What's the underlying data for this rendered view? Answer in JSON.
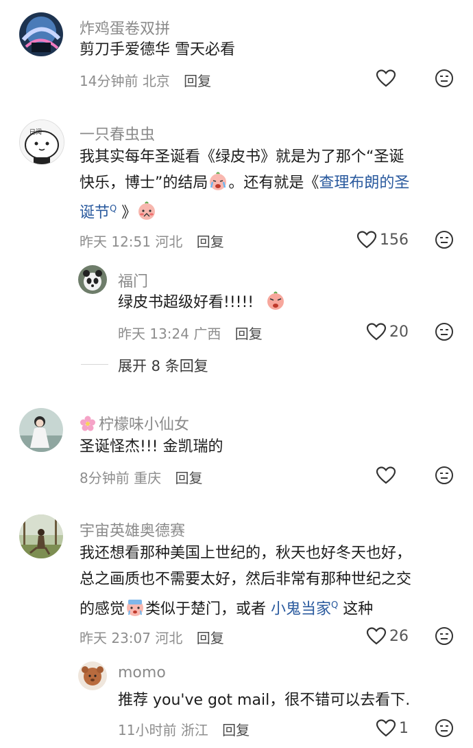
{
  "comments": [
    {
      "username": "炸鸡蛋卷双拼",
      "text": "剪刀手爱德华 雪天必看",
      "time": "14分钟前",
      "location": "北京",
      "reply_label": "回复",
      "likes": ""
    },
    {
      "username": "一只春虫虫",
      "text_line1": "我其实每年圣诞看《绿皮书》就是为了那个“圣诞",
      "text_line2a": "快乐，博士”的结局",
      "text_line2b": "。还有就是《",
      "text_line2c": "查理布朗的圣",
      "text_line3a": "诞节",
      "text_line3b": "》",
      "search_mark": "Q",
      "time": "昨天 12:51",
      "location": "河北",
      "reply_label": "回复",
      "likes": "156",
      "replies": [
        {
          "username": "福门",
          "text": "绿皮书超级好看!!!!!",
          "time": "昨天 13:24",
          "location": "广西",
          "reply_label": "回复",
          "likes": "20"
        }
      ],
      "expand_label": "展开 8 条回复"
    },
    {
      "username": "柠檬味小仙女",
      "text": "圣诞怪杰!!!  金凯瑞的",
      "time": "8分钟前",
      "location": "重庆",
      "reply_label": "回复",
      "likes": ""
    },
    {
      "username": "宇宙英雄奥德赛",
      "text_line1": "我还想看那种美国上世纪的，秋天也好冬天也好，",
      "text_line2": "总之画质也不需要太好，然后非常有那种世纪之交",
      "text_line3a": "的感觉",
      "text_line3b": "类似于楚门，或者",
      "text_line3c": "小鬼当家",
      "text_line3d": "这种",
      "time": "昨天 23:07",
      "location": "河北",
      "reply_label": "回复",
      "likes": "26",
      "replies": [
        {
          "username": "momo",
          "text": "推荐 you've got mail，很不错可以去看下.",
          "time": "11小时前",
          "location": "浙江",
          "reply_label": "回复",
          "likes": "1"
        }
      ]
    }
  ],
  "icons": {
    "like": "heart-outline-icon",
    "dislike": "neutral-face-icon"
  },
  "colors": {
    "link": "#2a5a9e",
    "meta": "#8d8d8d",
    "name": "#8a8a8a"
  }
}
